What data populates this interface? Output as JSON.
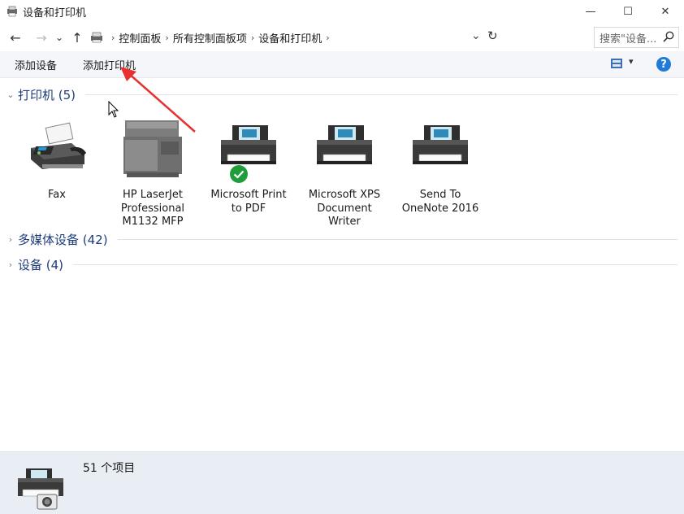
{
  "window": {
    "title": "设备和打印机",
    "minimize_glyph": "—",
    "maximize_glyph": "☐",
    "close_glyph": "✕"
  },
  "nav": {
    "back_glyph": "←",
    "forward_glyph": "→",
    "recent_glyph": "⌄",
    "up_glyph": "↑",
    "breadcrumbs": [
      "控制面板",
      "所有控制面板项",
      "设备和打印机"
    ],
    "separator": "›",
    "refresh_glyph": "↻",
    "search_placeholder": "搜索\"设备..."
  },
  "commands": {
    "add_device": "添加设备",
    "add_printer": "添加打印机",
    "view_drop": "▾",
    "help": "?"
  },
  "groups": {
    "printers": {
      "title": "打印机 (5)",
      "chevron": "⌄"
    },
    "multimedia": {
      "title": "多媒体设备 (42)",
      "chevron": "›"
    },
    "devices": {
      "title": "设备 (4)",
      "chevron": "›"
    }
  },
  "printers": [
    {
      "line1": "Fax",
      "line2": "",
      "line3": "",
      "icon": "fax-icon"
    },
    {
      "line1": "HP LaserJet",
      "line2": "Professional",
      "line3": "M1132 MFP",
      "icon": "mfp-printer-icon"
    },
    {
      "line1": "Microsoft Print",
      "line2": "to PDF",
      "line3": "",
      "icon": "printer-icon",
      "default": true
    },
    {
      "line1": "Microsoft XPS",
      "line2": "Document",
      "line3": "Writer",
      "icon": "printer-icon"
    },
    {
      "line1": "Send To",
      "line2": "OneNote 2016",
      "line3": "",
      "icon": "printer-icon"
    }
  ],
  "status": {
    "count_text": "51 个项目"
  },
  "colors": {
    "group_title": "#1e3c7a",
    "annotation_arrow": "#e8312f",
    "default_check": "#1f9d3a",
    "help_blue": "#1f7bd6"
  }
}
